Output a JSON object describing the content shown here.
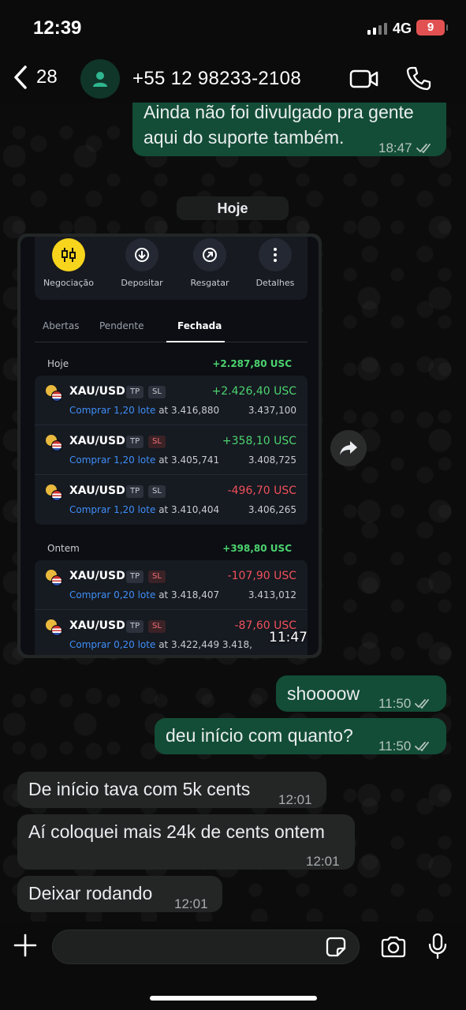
{
  "status_bar": {
    "time": "12:39",
    "network": "4G",
    "battery": "9"
  },
  "header": {
    "back_count": "28",
    "contact_name": "+55 12 98233-2108"
  },
  "date_chip": "Hoje",
  "messages": [
    {
      "text_line1": "Ainda não foi divulgado pra gente",
      "text_line2": "aqui do suporte também.",
      "time": "18:47"
    },
    {
      "text": "shoooow",
      "time": "11:50"
    },
    {
      "text": "deu início com quanto?",
      "time": "11:50"
    },
    {
      "text": "De início tava com 5k cents",
      "time": "12:01"
    },
    {
      "text": "Aí coloquei mais 24k de cents ontem",
      "time": "12:01"
    },
    {
      "text": "Deixar rodando",
      "time": "12:01"
    }
  ],
  "image_message": {
    "time": "11:47",
    "actions": [
      "Negociação",
      "Depositar",
      "Resgatar",
      "Detalhes"
    ],
    "tabs": [
      "Abertas",
      "Pendente",
      "Fechada"
    ],
    "groups": [
      {
        "title": "Hoje",
        "total": "+2.287,80 USC",
        "trades": [
          {
            "symbol": "XAU/USD",
            "tp": "TP",
            "sl": "SL",
            "pnl": "+2.426,40 USC",
            "side": "Comprar 1,20 lote",
            "open": "at 3.416,880",
            "close": "3.437,100"
          },
          {
            "symbol": "XAU/USD",
            "tp": "TP",
            "sl": "SL",
            "pnl": "+358,10 USC",
            "side": "Comprar 1,20 lote",
            "open": "at 3.405,741",
            "close": "3.408,725"
          },
          {
            "symbol": "XAU/USD",
            "tp": "TP",
            "sl": "SL",
            "pnl": "-496,70 USC",
            "side": "Comprar 1,20 lote",
            "open": "at 3.410,404",
            "close": "3.406,265"
          }
        ]
      },
      {
        "title": "Ontem",
        "total": "+398,80 USC",
        "trades": [
          {
            "symbol": "XAU/USD",
            "tp": "TP",
            "sl": "SL",
            "pnl": "-107,90 USC",
            "side": "Comprar 0,20 lote",
            "open": "at 3.418,407",
            "close": "3.413,012"
          },
          {
            "symbol": "XAU/USD",
            "tp": "TP",
            "sl": "SL",
            "pnl": "-87,60 USC",
            "side": "Comprar 0,20 lote",
            "open": "at 3.422,449",
            "close": "3.418,"
          }
        ]
      }
    ]
  },
  "colors": {
    "outgoing_bubble": "#134d37",
    "incoming_bubble": "#242626",
    "accent_yellow": "#f7d51d",
    "profit_green": "#4cd36f",
    "loss_red": "#f0505a"
  },
  "icons": [
    "chevron-left-icon",
    "person-icon",
    "video-camera-icon",
    "phone-icon",
    "forward-icon",
    "plus-icon",
    "sticker-icon",
    "camera-icon",
    "microphone-icon",
    "double-check-icon"
  ]
}
